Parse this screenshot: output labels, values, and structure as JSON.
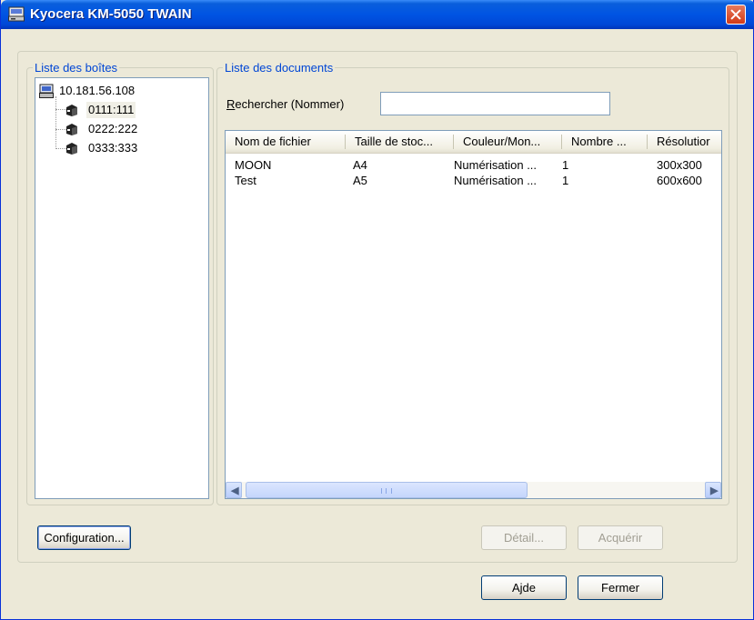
{
  "window": {
    "title": "Kyocera KM-5050 TWAIN"
  },
  "boxes_group": {
    "legend": "Liste des boîtes",
    "root": "10.181.56.108",
    "items": [
      {
        "label": "0111:111",
        "selected": true
      },
      {
        "label": "0222:222",
        "selected": false
      },
      {
        "label": "0333:333",
        "selected": false
      }
    ]
  },
  "documents_group": {
    "legend": "Liste des documents",
    "search_label_mnemonic": "R",
    "search_label_rest": "echercher (Nommer)",
    "search_value": "",
    "columns": [
      "Nom de fichier",
      "Taille de stoc...",
      "Couleur/Mon...",
      "Nombre ...",
      "Résolutior"
    ],
    "rows": [
      [
        "MOON",
        "A4",
        "Numérisation ...",
        "1",
        "300x300"
      ],
      [
        "Test",
        "A5",
        "Numérisation ...",
        "1",
        "600x600"
      ]
    ]
  },
  "buttons": {
    "configuration": "Configuration...",
    "detail": "Détail...",
    "acquire": "Acquérir",
    "help": "Ajde",
    "close": "Fermer"
  },
  "icons": {
    "app": "scanner-icon",
    "root": "computer-icon",
    "box": "box-icon"
  },
  "colors": {
    "titlebar": "#0054e3",
    "legend_text": "#0046d5",
    "dialog_bg": "#ece9d8"
  }
}
